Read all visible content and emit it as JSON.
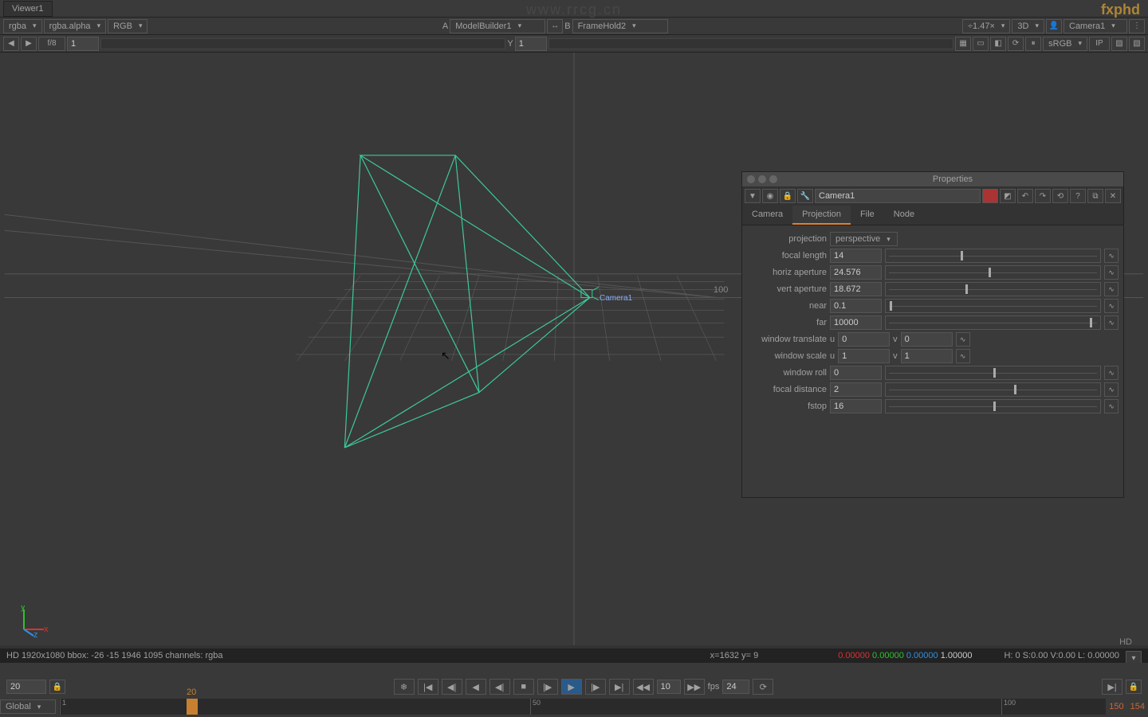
{
  "viewer": {
    "tab": "Viewer1"
  },
  "channels": {
    "layer": "rgba",
    "channel": "rgba.alpha",
    "mode": "RGB"
  },
  "fstopbar": {
    "f": "f/8",
    "frame": "1",
    "y_label": "Y",
    "y_val": "1",
    "zoom": "÷1.47×",
    "view": "3D",
    "camera": "Camera1",
    "colorspace": "sRGB",
    "ip": "IP"
  },
  "inputs": {
    "a_label": "A",
    "a_val": "ModelBuilder1",
    "b_label": "B",
    "b_val": "FrameHold2"
  },
  "viewport": {
    "camera_label": "Camera1",
    "grid_num": "100"
  },
  "properties": {
    "title": "Properties",
    "node_name": "Camera1",
    "tabs": [
      "Camera",
      "Projection",
      "File",
      "Node"
    ],
    "active_tab": "Projection",
    "projection": {
      "label": "projection",
      "value": "perspective"
    },
    "focal_length": {
      "label": "focal length",
      "value": "14"
    },
    "horiz_aperture": {
      "label": "horiz aperture",
      "value": "24.576"
    },
    "vert_aperture": {
      "label": "vert aperture",
      "value": "18.672"
    },
    "near": {
      "label": "near",
      "value": "0.1"
    },
    "far": {
      "label": "far",
      "value": "10000"
    },
    "win_translate": {
      "label": "window translate",
      "u": "0",
      "v": "0"
    },
    "win_scale": {
      "label": "window scale",
      "u": "1",
      "v": "1"
    },
    "win_roll": {
      "label": "window roll",
      "value": "0"
    },
    "focal_distance": {
      "label": "focal distance",
      "value": "2"
    },
    "fstop": {
      "label": "fstop",
      "value": "16"
    }
  },
  "status": {
    "left": "HD 1920x1080 bbox: -26 -15 1946 1095 channels: rgba",
    "coords": "x=1632 y=    9",
    "r": "0.00000",
    "g": "0.00000",
    "b": "0.00000",
    "a": "1.00000",
    "right": "H:   0 S:0.00 V:0.00   L: 0.00000"
  },
  "transport": {
    "frame_in": "20",
    "fps_label": "fps",
    "fps": "24",
    "step": "10"
  },
  "timeline": {
    "global": "Global",
    "start": "1",
    "mid": "50",
    "end": "100",
    "cur": "20",
    "out1": "150",
    "out2": "154",
    "hd": "HD"
  },
  "watermark": {
    "url": "www.rrcg.cn",
    "logo": "fxphd"
  }
}
